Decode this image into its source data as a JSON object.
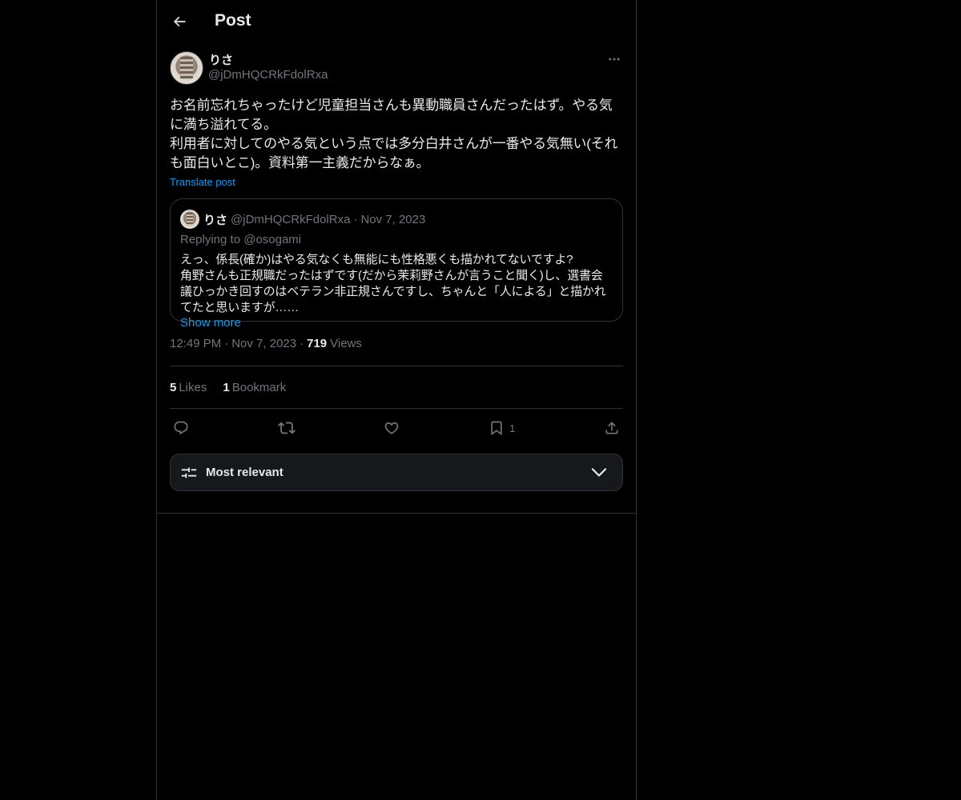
{
  "header": {
    "title": "Post"
  },
  "post": {
    "display_name": "りさ",
    "handle": "@jDmHQCRkFdolRxa",
    "text": "お名前忘れちゃったけど児童担当さんも異動職員さんだったはず。やる気に満ち溢れてる。\n利用者に対してのやる気という点では多分白井さんが一番やる気無い(それも面白いとこ)。資料第一主義だからなぁ。",
    "translate_label": "Translate post",
    "time": "12:49 PM",
    "date": "Nov 7, 2023",
    "views_count": "719",
    "views_label": "Views",
    "likes_count": "5",
    "likes_label": "Likes",
    "bookmarks_count": "1",
    "bookmarks_label": "Bookmark",
    "bookmark_action_count": "1"
  },
  "quote": {
    "display_name": "りさ",
    "handle": "@jDmHQCRkFdolRxa",
    "separator": "·",
    "date": "Nov 7, 2023",
    "replying": "Replying to @osogami",
    "text": "えっ、係長(確か)はやる気なくも無能にも性格悪くも描かれてないですよ?\n角野さんも正規職だったはずです(だから茉莉野さんが言うこと聞く)し、選書会議ひっかき回すのはベテラン非正規さんですし、ちゃんと「人による」と描かれてたと思いますが……",
    "show_more": "Show more"
  },
  "meta": {
    "separator": "·"
  },
  "sort": {
    "label": "Most relevant"
  },
  "colors": {
    "background": "#000000",
    "text": "#e7e9ea",
    "muted": "#71767b",
    "accent": "#1d9bf0",
    "border": "#2f3336"
  },
  "icons": {
    "back": "arrow-left-icon",
    "more": "more-horizontal-icon",
    "reply": "reply-icon",
    "repost": "repost-icon",
    "like": "heart-icon",
    "bookmark": "bookmark-icon",
    "share": "share-icon",
    "sort": "sliders-icon",
    "chevron": "chevron-down-icon"
  }
}
